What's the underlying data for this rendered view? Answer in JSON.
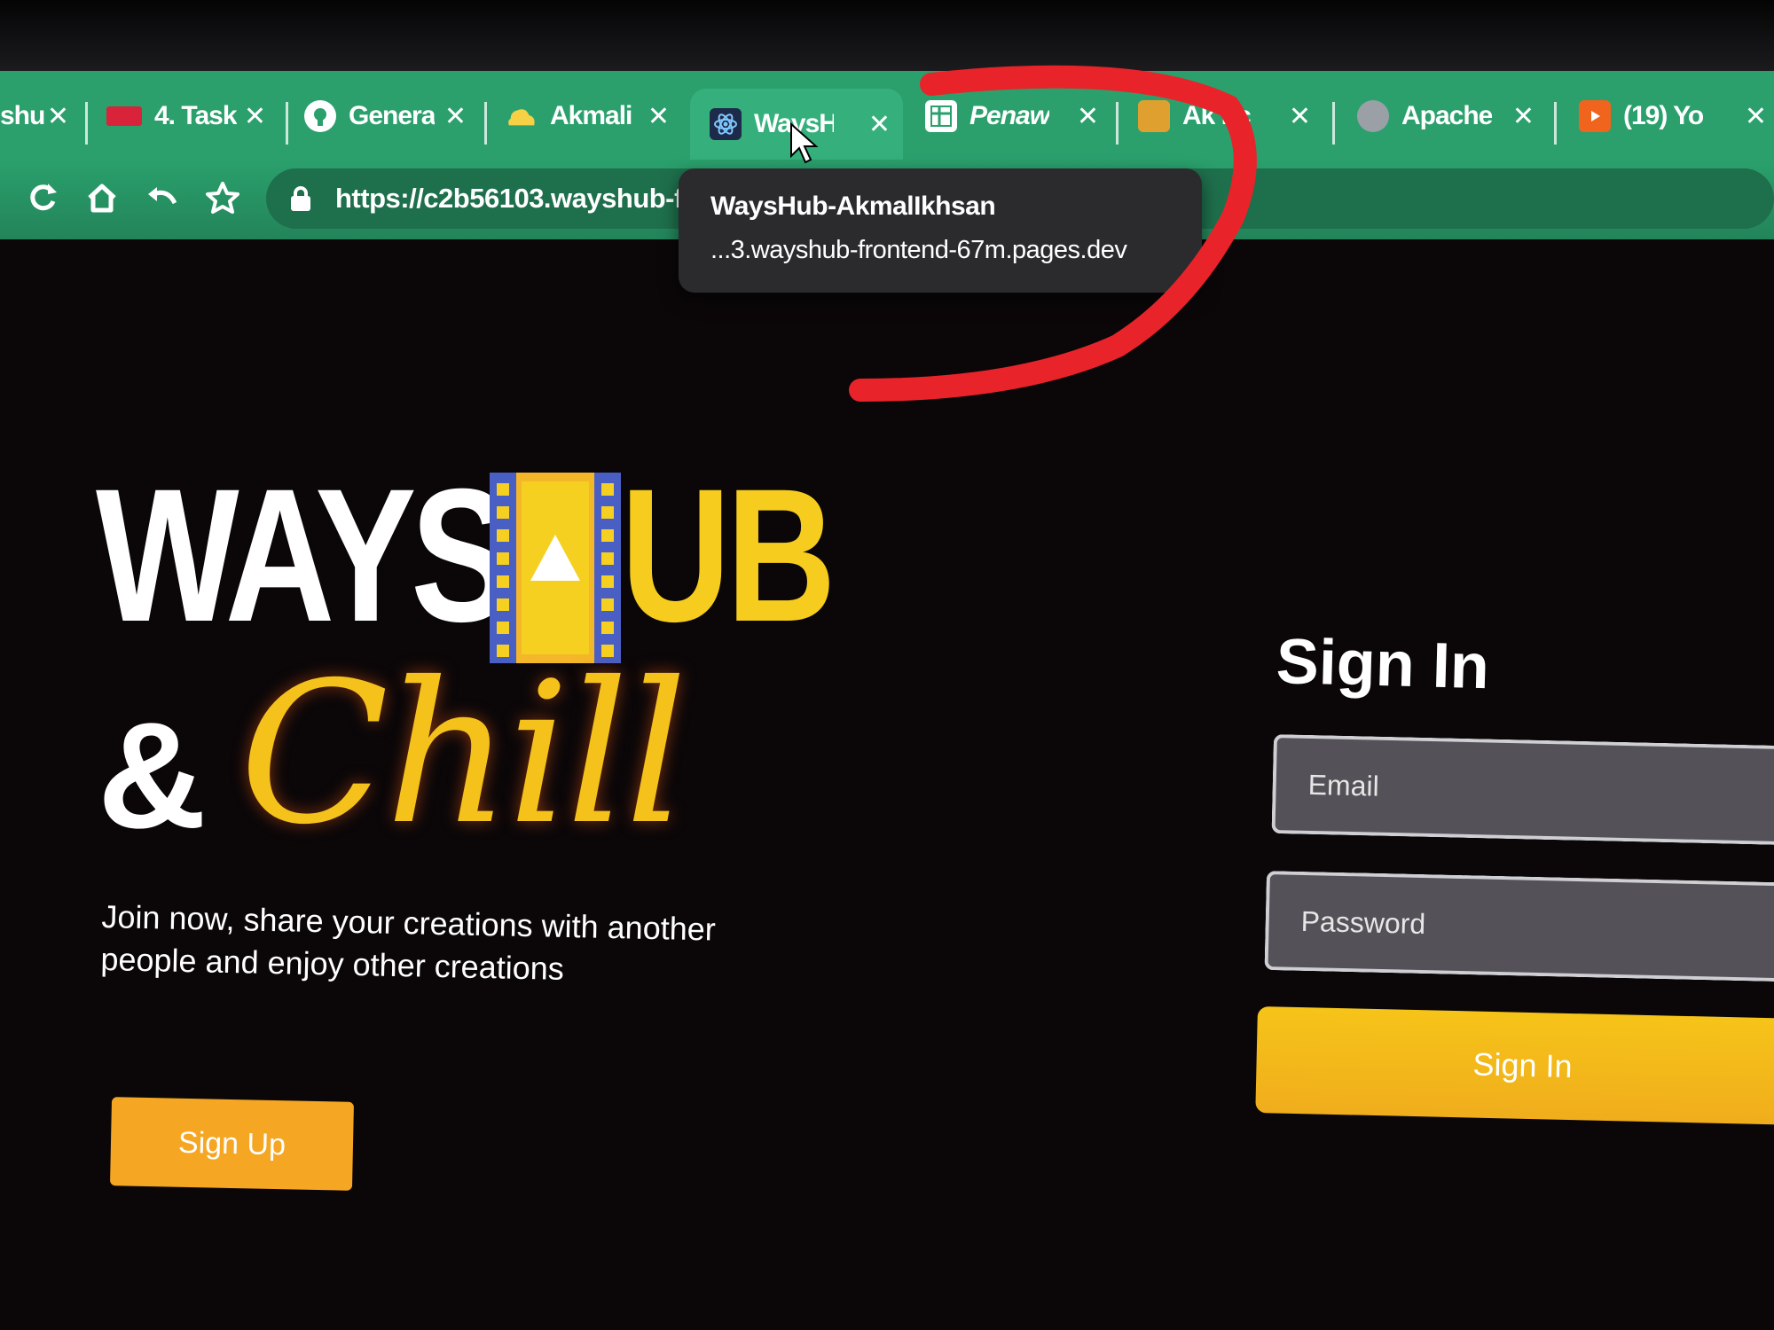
{
  "browser": {
    "tabs": [
      {
        "title": "shu",
        "favicon": "generic-icon",
        "color": "#ffffff"
      },
      {
        "title": "4. Task",
        "favicon": "task-icon",
        "color": "#d8233b"
      },
      {
        "title": "Genera",
        "favicon": "github-icon",
        "color": "#ffffff"
      },
      {
        "title": "Akmali",
        "favicon": "cloud-icon",
        "color": "#f6d145"
      },
      {
        "title": "WaysH",
        "favicon": "react-icon",
        "color": "#1d2a4a",
        "active": true
      },
      {
        "title": "Penaw",
        "favicon": "sheets-icon",
        "color": "#ffffff"
      },
      {
        "title": "Ak nc",
        "favicon": "avatar-icon",
        "color": "#e0a030"
      },
      {
        "title": "Apache",
        "favicon": "globe-icon",
        "color": "#9aa0a6"
      },
      {
        "title": "(19) Yo",
        "favicon": "youtube-icon",
        "color": "#f0641e"
      }
    ],
    "close_glyph": "✕",
    "url": "https://c2b56103.wayshub-fr",
    "tooltip": {
      "title": "WaysHub-AkmalIkhsan",
      "url": "...3.wayshub-frontend-67m.pages.dev"
    },
    "theme_color": "#2ba06d"
  },
  "hero": {
    "logo_ways": "WAYS",
    "logo_ub": "UB",
    "logo_amp": "&",
    "logo_chill": "Chill",
    "tagline": "Join now, share your creations with another people and enjoy other creations",
    "signup_label": "Sign Up"
  },
  "signin": {
    "title": "Sign In",
    "email_placeholder": "Email",
    "password_placeholder": "Password",
    "button_label": "Sign In"
  },
  "colors": {
    "background": "#0b0709",
    "accent_yellow": "#f6cd1e",
    "accent_orange": "#f5a623",
    "annotation_red": "#e8242a"
  }
}
